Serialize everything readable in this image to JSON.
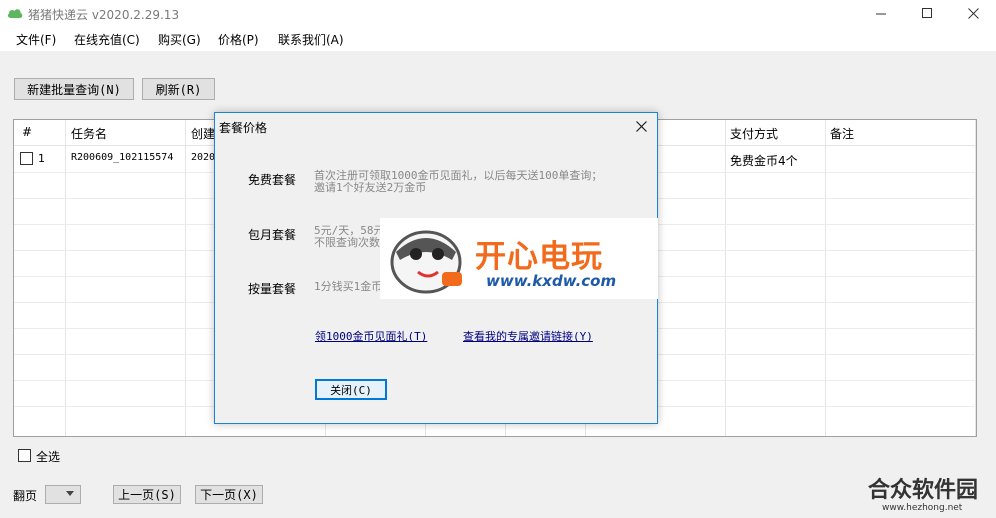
{
  "window": {
    "title": "猪猪快递云 v2020.2.29.13"
  },
  "menu": [
    "文件(F)",
    "在线充值(C)",
    "购买(G)",
    "价格(P)",
    "联系我们(A)"
  ],
  "toolbar": {
    "new_query": "新建批量查询(N)",
    "refresh": "刷新(R)"
  },
  "table": {
    "headers": [
      "#",
      "任务名",
      "创建",
      "支付方式",
      "备注"
    ],
    "rows": [
      {
        "index": "1",
        "task_name": "R200609_102115574",
        "created": "2020",
        "payment": "免费金币4个",
        "note": ""
      }
    ]
  },
  "bottom": {
    "select_all": "全选",
    "page_label": "翻页",
    "prev": "上一页(S)",
    "next": "下一页(X)"
  },
  "dialog": {
    "title": "套餐价格",
    "packages": [
      {
        "label": "免费套餐",
        "desc_line1": "首次注册可领取1000金币见面礼，以后每天送100单查询；",
        "desc_line2": "邀请1个好友送2万金币"
      },
      {
        "label": "包月套餐",
        "desc_line1": "5元/天，58元",
        "desc_line2": "不限查询次数"
      },
      {
        "label": "按量套餐",
        "desc_line1": "1分钱买1金币",
        "desc_line2": ""
      }
    ],
    "link_gift": "领1000金币见面礼(T)",
    "link_invite": "查看我的专属邀请链接(Y)",
    "close_button": "关闭(C)"
  },
  "watermark": {
    "brand": "开心电玩",
    "url": "www.kxdw.com",
    "footer_brand": "合众软件园",
    "footer_url": "www.hezhong.net"
  },
  "colors": {
    "accent_border": "#1883d7",
    "watermark_orange": "#f26a1b",
    "watermark_blue": "#1e5aa8"
  }
}
